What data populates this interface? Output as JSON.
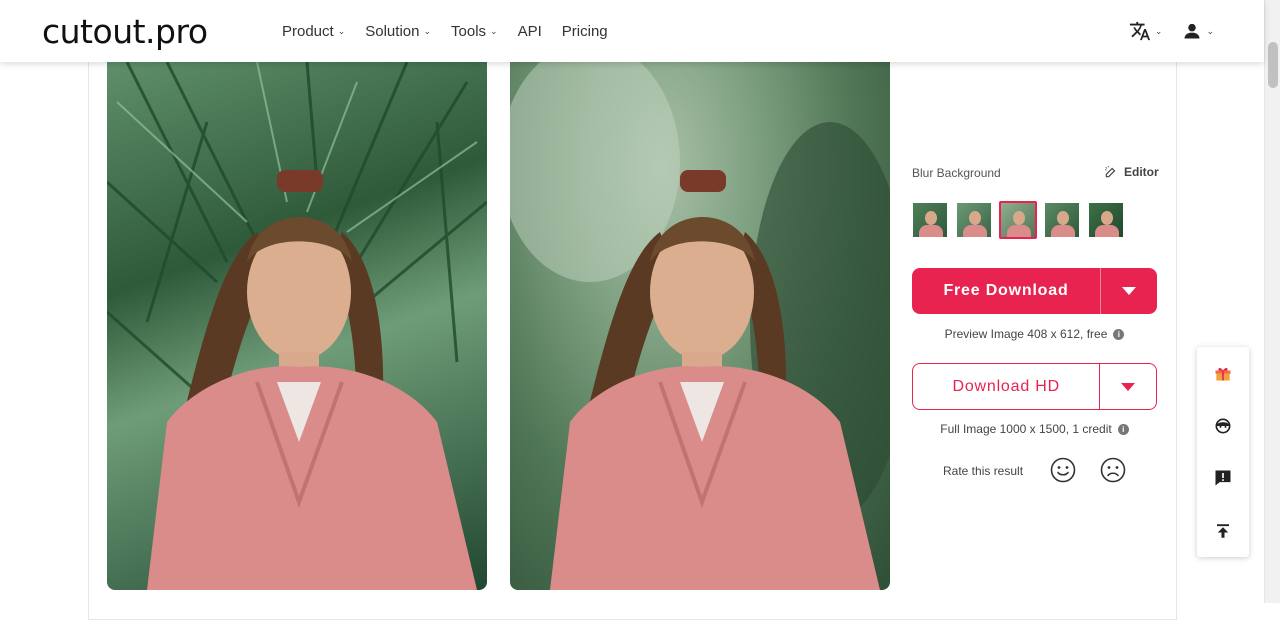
{
  "header": {
    "logo": "cutout.pro",
    "nav": [
      {
        "label": "Product",
        "has_dropdown": true
      },
      {
        "label": "Solution",
        "has_dropdown": true
      },
      {
        "label": "Tools",
        "has_dropdown": true
      },
      {
        "label": "API",
        "has_dropdown": false
      },
      {
        "label": "Pricing",
        "has_dropdown": false
      }
    ],
    "icons": [
      "translate-icon",
      "user-icon"
    ]
  },
  "panel": {
    "effect_label": "Blur Background",
    "editor_label": "Editor",
    "thumbnails": [
      "thumb-1",
      "thumb-2",
      "thumb-3",
      "thumb-4",
      "thumb-5"
    ],
    "selected_thumbnail": 3,
    "free_download_label": "Free Download",
    "preview_note": "Preview Image 408 x 612, free",
    "download_hd_label": "Download HD",
    "full_note": "Full Image 1000 x 1500, 1 credit",
    "rate_label": "Rate this result"
  },
  "colors": {
    "accent": "#e8234f"
  },
  "side_toolbar": [
    "gift-icon",
    "support-icon",
    "feedback-icon",
    "back-to-top-icon"
  ]
}
